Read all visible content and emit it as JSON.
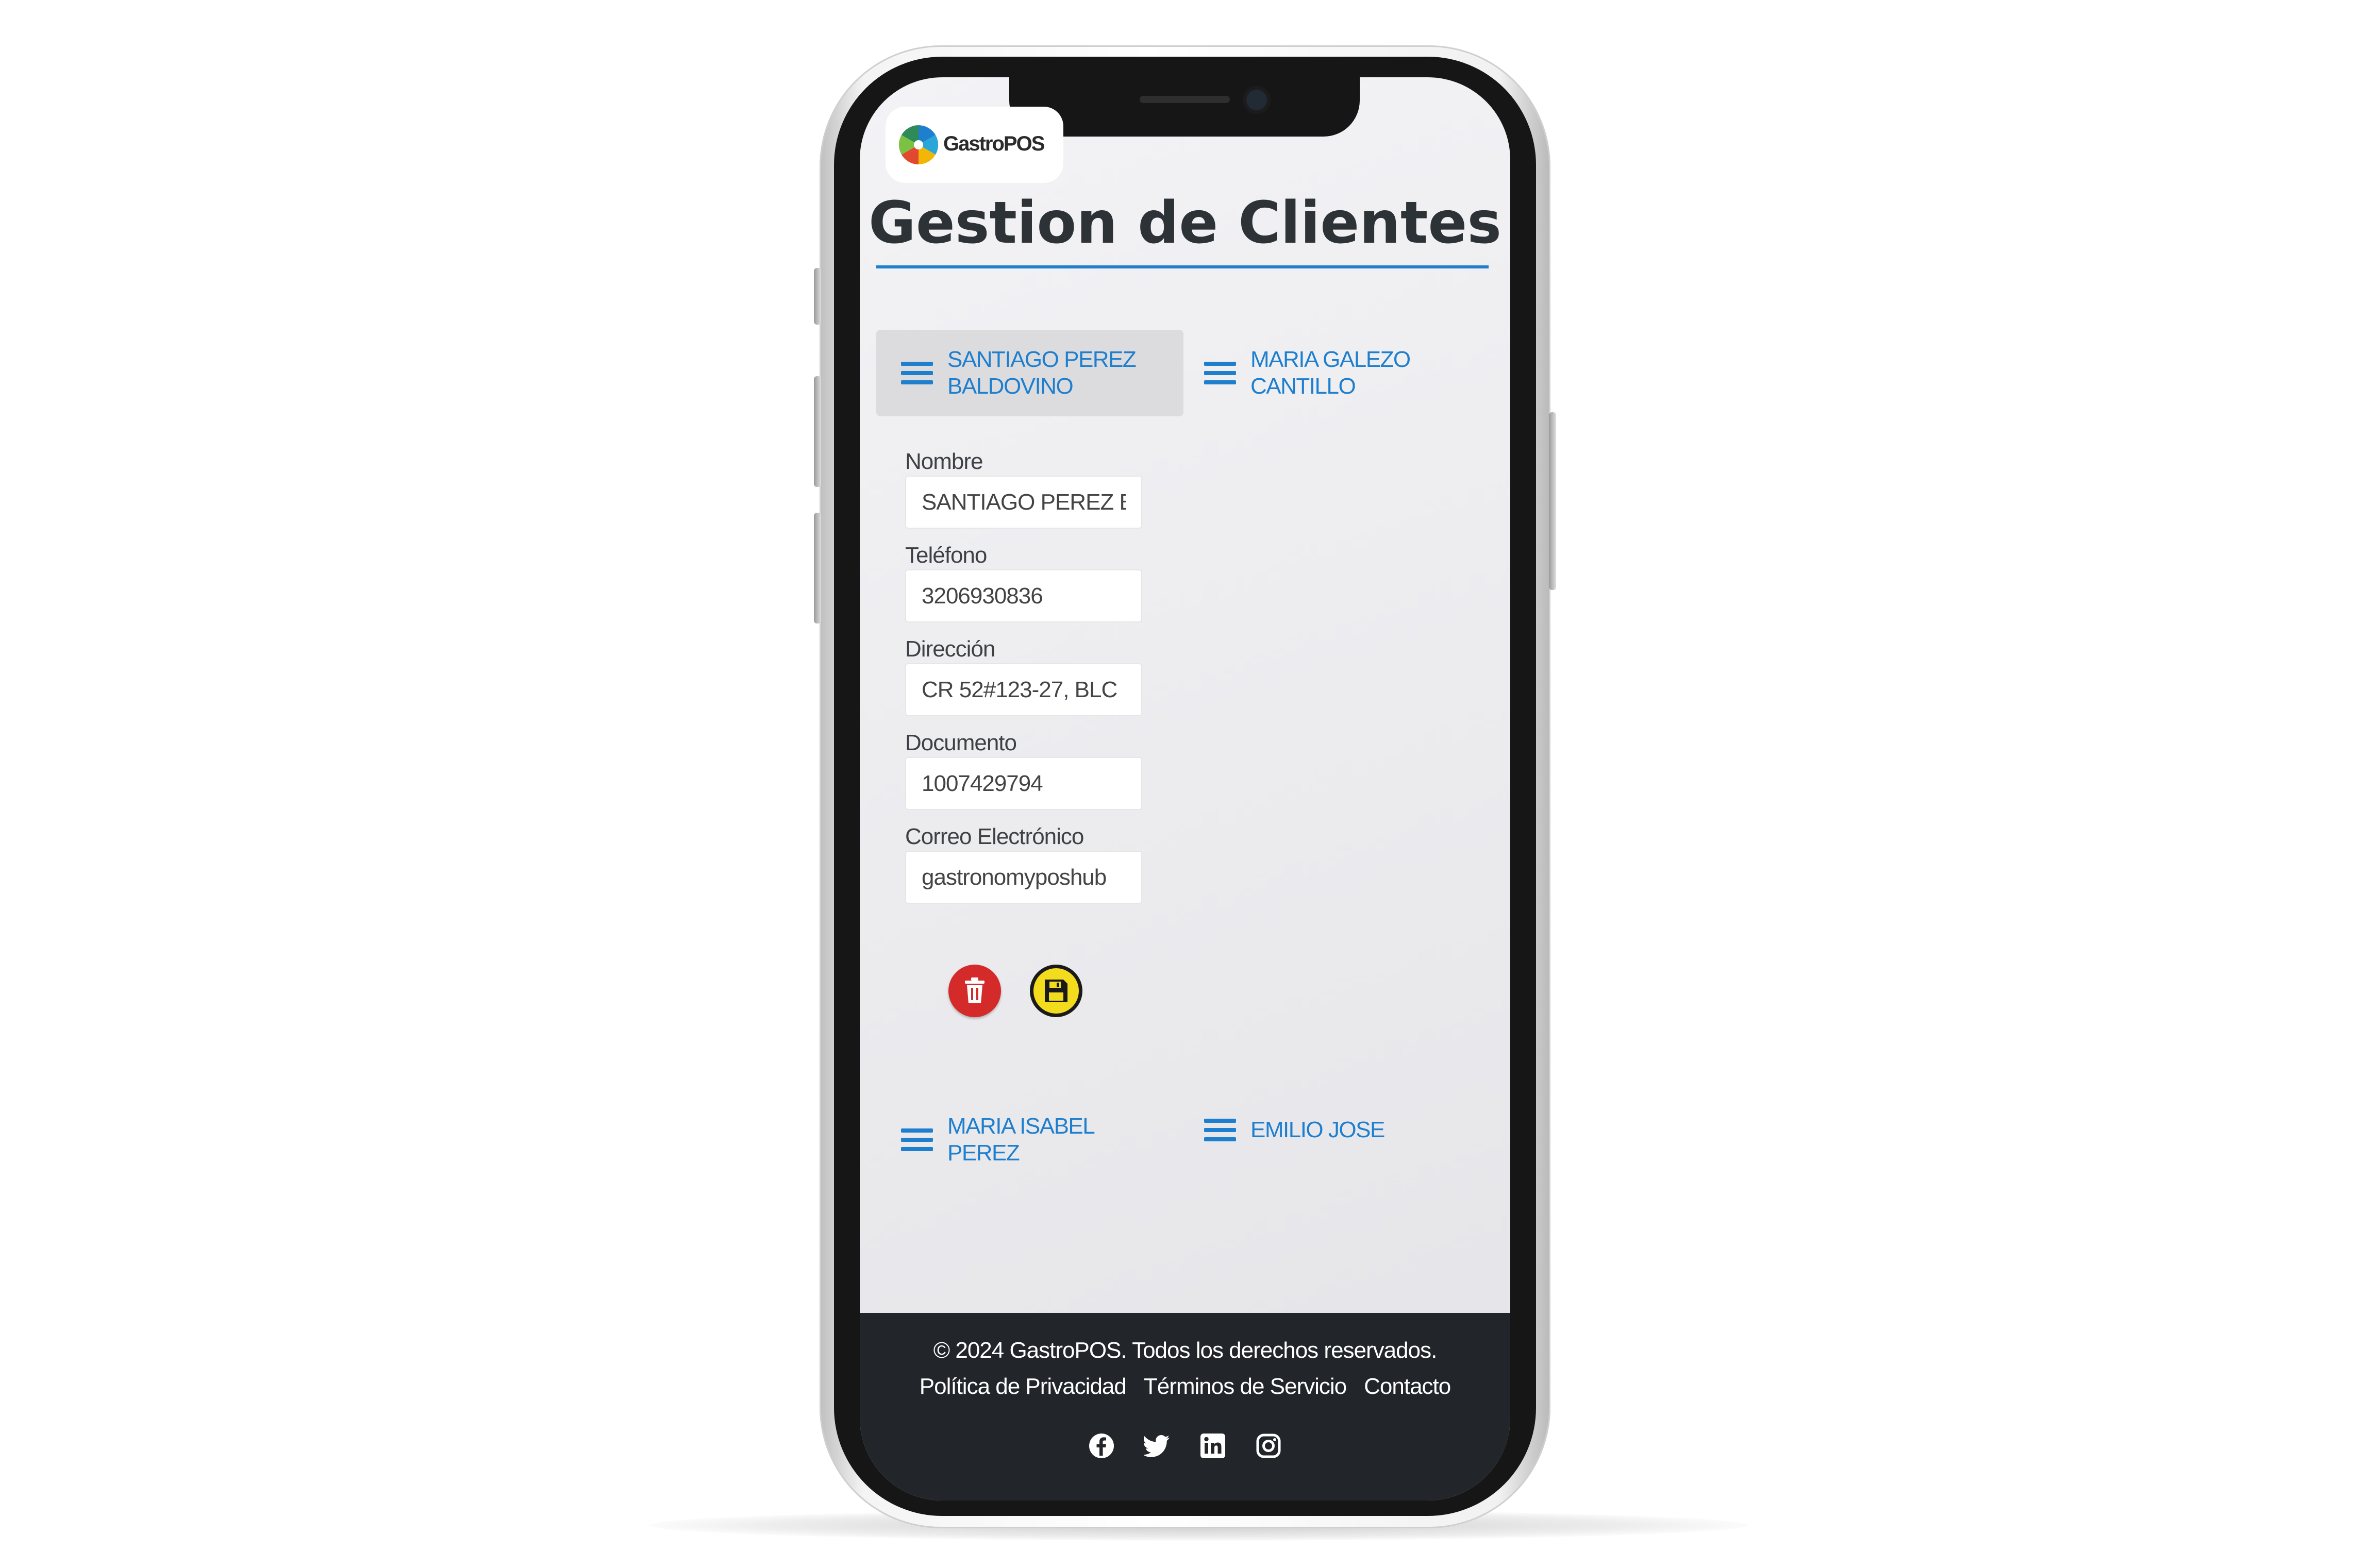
{
  "app": {
    "logo_text": "GastroPOS",
    "brand_color": "#1e7fcf"
  },
  "page": {
    "title": "Gestion de Clientes"
  },
  "clients": [
    {
      "name": "SANTIAGO PEREZ BALDOVINO",
      "active": true
    },
    {
      "name": "MARIA GALEZO CANTILLO",
      "active": false
    },
    {
      "name": "MARIA ISABEL PEREZ",
      "active": false
    },
    {
      "name": "EMILIO JOSE",
      "active": false
    }
  ],
  "form": {
    "nombre_label": "Nombre",
    "nombre_value": "SANTIAGO PEREZ BALDOVINO",
    "telefono_label": "Teléfono",
    "telefono_value": "3206930836",
    "direccion_label": "Dirección",
    "direccion_value": "CR 52#123-27, BLC",
    "documento_label": "Documento",
    "documento_value": "1007429794",
    "correo_label": "Correo Electrónico",
    "correo_value": "gastronomyposhub",
    "delete_icon": "trash-icon",
    "save_icon": "floppy-disk-icon",
    "delete_color": "#d52a2a",
    "save_color": "#f3dc1d"
  },
  "footer": {
    "copyright": "© 2024 GastroPOS. Todos los derechos reservados.",
    "links": [
      "Política de Privacidad",
      "Términos de Servicio",
      "Contacto"
    ],
    "social_icons": [
      "facebook-icon",
      "twitter-icon",
      "linkedin-icon",
      "instagram-icon"
    ],
    "background": "#22262a"
  }
}
